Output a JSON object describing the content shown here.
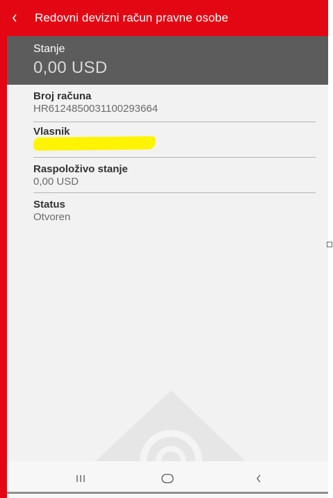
{
  "app_bar": {
    "title": "Redovni devizni račun pravne osobe",
    "back_icon": "chevron-left-icon"
  },
  "balance": {
    "label": "Stanje",
    "value": "0,00 USD"
  },
  "details": [
    {
      "label": "Broj računa",
      "value": "HR6124850031100293664"
    },
    {
      "label": "Vlasnik",
      "value": "",
      "redacted": true
    },
    {
      "label": "Raspoloživo stanje",
      "value": "0,00 USD"
    },
    {
      "label": "Status",
      "value": "Otvoren"
    }
  ],
  "nav_bar": {
    "recents_icon": "recents-icon",
    "home_icon": "home-icon",
    "back_icon": "back-icon"
  },
  "colors": {
    "accent": "#e30613",
    "balance_bg": "#5c5c5c",
    "redaction": "#fff400"
  }
}
